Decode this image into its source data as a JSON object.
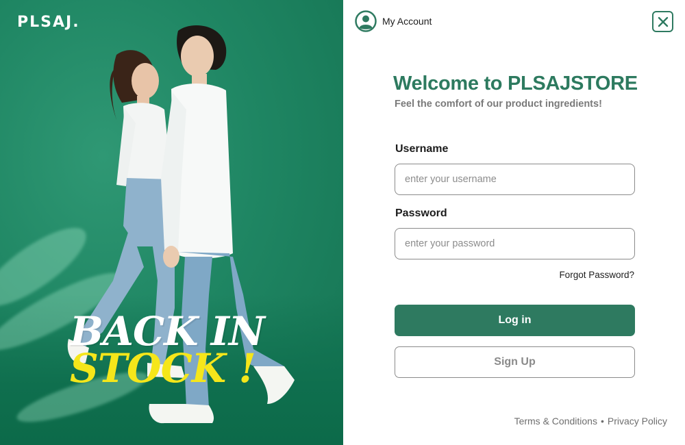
{
  "colors": {
    "brand_green": "#2e7a60",
    "hero_background": "#1f8663",
    "promo_yellow": "#f5e61a",
    "muted_text": "#7a7a7a"
  },
  "hero": {
    "brand_logo": "PLSAJ.",
    "promo_line1": "BACK IN",
    "promo_line2": "STOCK !"
  },
  "header": {
    "account_icon": "user-circle-icon",
    "account_label": "My Account",
    "close_icon": "close-icon"
  },
  "login": {
    "title": "Welcome to PLSAJSTORE",
    "subtitle": "Feel the comfort of our product ingredients!",
    "username_label": "Username",
    "username_placeholder": "enter your username",
    "username_value": "",
    "password_label": "Password",
    "password_placeholder": "enter your password",
    "password_value": "",
    "forgot_label": "Forgot Password?",
    "login_label": "Log in",
    "signup_label": "Sign Up"
  },
  "footer": {
    "terms_label": "Terms & Conditions",
    "separator": "•",
    "privacy_label": "Privacy Policy"
  }
}
